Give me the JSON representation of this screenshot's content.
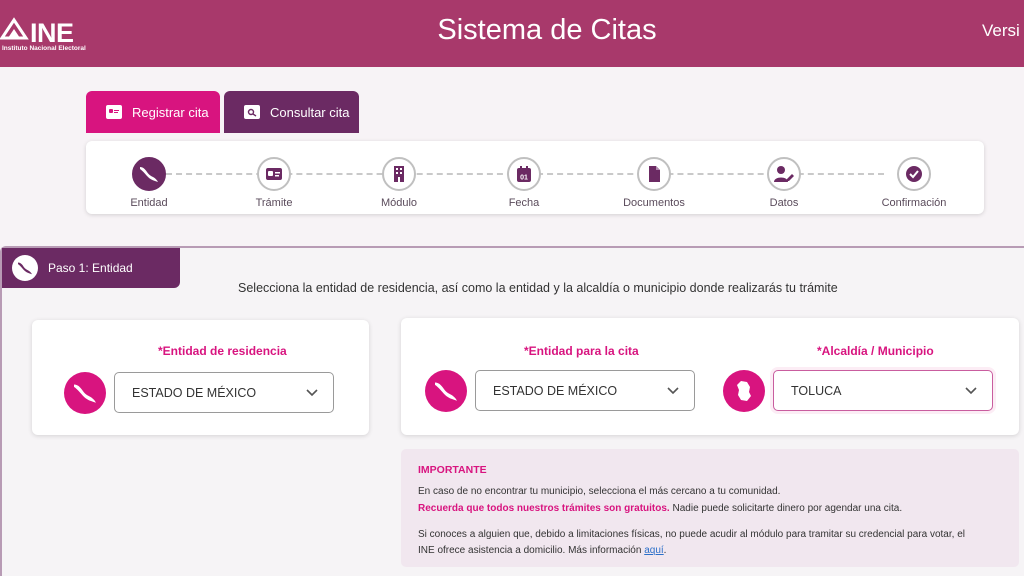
{
  "header": {
    "logo_text": "INE",
    "logo_subtitle": "Instituto Nacional Electoral",
    "title": "Sistema de Citas",
    "version_label": "Versi"
  },
  "tabs": [
    {
      "label": "Registrar cita",
      "icon": "id-card-icon"
    },
    {
      "label": "Consultar cita",
      "icon": "search-document-icon"
    }
  ],
  "stepper": {
    "steps": [
      {
        "label": "Entidad",
        "icon": "mexico-map-icon",
        "active": true
      },
      {
        "label": "Trámite",
        "icon": "id-card-icon",
        "active": false
      },
      {
        "label": "Módulo",
        "icon": "building-icon",
        "active": false
      },
      {
        "label": "Fecha",
        "icon": "calendar-icon",
        "active": false,
        "badge": "01"
      },
      {
        "label": "Documentos",
        "icon": "document-icon",
        "active": false
      },
      {
        "label": "Datos",
        "icon": "user-edit-icon",
        "active": false
      },
      {
        "label": "Confirmación",
        "icon": "check-circle-icon",
        "active": false
      }
    ]
  },
  "section": {
    "title": "Paso 1: Entidad",
    "instructions": "Selecciona la entidad de residencia, así como la entidad y la alcaldía o municipio donde realizarás tu trámite"
  },
  "fields": {
    "residence": {
      "label": "*Entidad de residencia",
      "value": "ESTADO DE MÉXICO"
    },
    "appointment_entity": {
      "label": "*Entidad para la cita",
      "value": "ESTADO DE MÉXICO"
    },
    "municipality": {
      "label": "*Alcaldía / Municipio",
      "value": "TOLUCA"
    }
  },
  "important": {
    "title": "IMPORTANTE",
    "line1": "En caso de no encontrar tu municipio, selecciona el más cercano a tu comunidad.",
    "line2_highlight": "Recuerda que todos nuestros trámites son gratuitos.",
    "line2_rest": " Nadie puede solicitarte dinero por agendar una cita.",
    "line3": "Si conoces a alguien que, debido a limitaciones físicas, no puede acudir al módulo para tramitar su credencial para votar, el",
    "line4_start": "INE ofrece asistencia a domicilio. Más información ",
    "line4_link": "aquí",
    "line4_end": "."
  },
  "colors": {
    "header": "#a8396b",
    "accent_pink": "#d8147f",
    "accent_purple": "#6b2a63",
    "important_bg": "#f1e7ef",
    "link": "#2b6fc9"
  }
}
